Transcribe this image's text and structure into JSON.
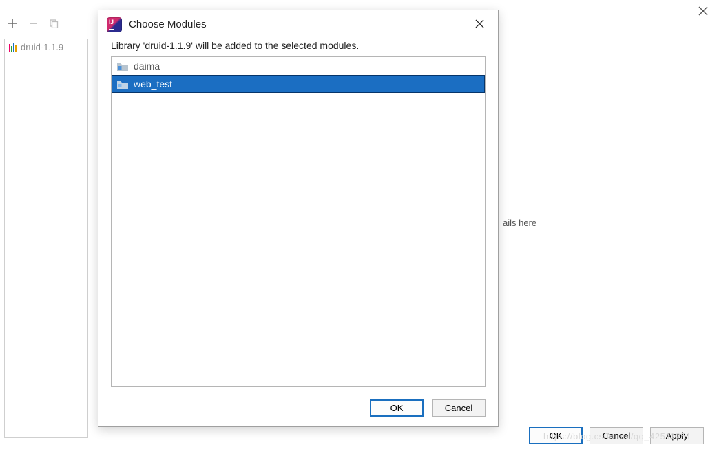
{
  "parent": {
    "library_item": "druid-1.1.9",
    "details_hint": "ails here",
    "buttons": {
      "ok": "OK",
      "cancel": "Cancel",
      "apply": "Apply"
    }
  },
  "dialog": {
    "title": "Choose Modules",
    "message": "Library 'druid-1.1.9' will be added to the selected modules.",
    "modules": [
      {
        "name": "daima",
        "selected": false
      },
      {
        "name": "web_test",
        "selected": true
      }
    ],
    "buttons": {
      "ok": "OK",
      "cancel": "Cancel"
    }
  },
  "watermark": "https://blog.csdn.net/qq_42511251",
  "icons": {
    "add": "add-icon",
    "remove": "remove-icon",
    "copy": "copy-icon",
    "close": "close-icon",
    "folder": "folder-icon",
    "app": "intellij-logo-icon",
    "library": "library-bars-icon"
  }
}
